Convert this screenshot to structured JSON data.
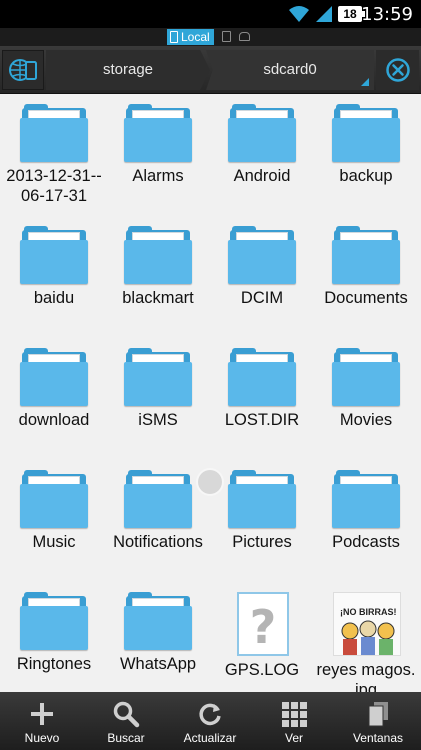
{
  "status_bar": {
    "time": "13:59",
    "notification_count": "18"
  },
  "mode_strip": {
    "active_label": "Local"
  },
  "path_bar": {
    "crumbs": [
      "storage",
      "sdcard0"
    ]
  },
  "items": [
    {
      "name": "2013-12-31--06-17-31",
      "type": "folder"
    },
    {
      "name": "Alarms",
      "type": "folder"
    },
    {
      "name": "Android",
      "type": "folder"
    },
    {
      "name": "backup",
      "type": "folder"
    },
    {
      "name": "baidu",
      "type": "folder"
    },
    {
      "name": "blackmart",
      "type": "folder"
    },
    {
      "name": "DCIM",
      "type": "folder"
    },
    {
      "name": "Documents",
      "type": "folder"
    },
    {
      "name": "download",
      "type": "folder"
    },
    {
      "name": "iSMS",
      "type": "folder"
    },
    {
      "name": "LOST.DIR",
      "type": "folder"
    },
    {
      "name": "Movies",
      "type": "folder"
    },
    {
      "name": "Music",
      "type": "folder"
    },
    {
      "name": "Notifications",
      "type": "folder"
    },
    {
      "name": "Pictures",
      "type": "folder"
    },
    {
      "name": "Podcasts",
      "type": "folder"
    },
    {
      "name": "Ringtones",
      "type": "folder"
    },
    {
      "name": "WhatsApp",
      "type": "folder"
    },
    {
      "name": "GPS.LOG",
      "type": "file",
      "icon": "unknown-file-icon"
    },
    {
      "name": "reyes magos.jpg",
      "type": "image",
      "icon": "image-thumbnail",
      "thumb_caption": "¡NO BIRRAS!"
    }
  ],
  "bottom_bar": {
    "buttons": [
      {
        "label": "Nuevo",
        "icon": "plus-icon"
      },
      {
        "label": "Buscar",
        "icon": "search-icon"
      },
      {
        "label": "Actualizar",
        "icon": "refresh-icon"
      },
      {
        "label": "Ver",
        "icon": "grid-view-icon"
      },
      {
        "label": "Ventanas",
        "icon": "windows-icon"
      }
    ]
  },
  "colors": {
    "accent": "#2fa6d8",
    "folder_front": "#5ab8ea",
    "folder_back": "#3a9ed3",
    "content_bg": "#f1f1f1"
  }
}
